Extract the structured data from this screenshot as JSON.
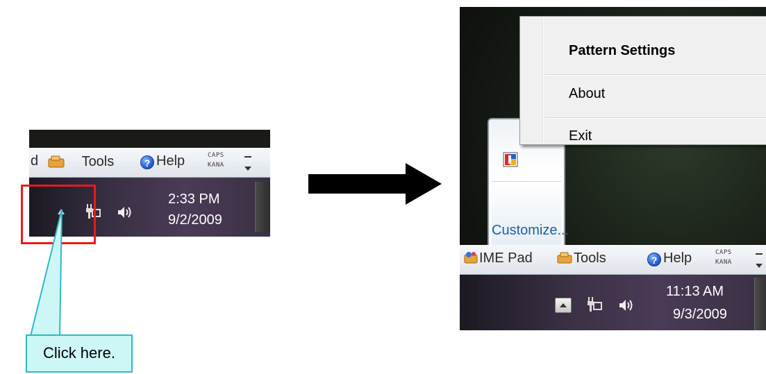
{
  "left": {
    "langbar": {
      "ime_fragment": "d",
      "tools": "Tools",
      "help": "Help",
      "caps": "CAPS",
      "kana": "KANA"
    },
    "clock": {
      "time": "2:33 PM",
      "date": "9/2/2009"
    }
  },
  "callout": {
    "text": "Click here."
  },
  "right": {
    "menu": {
      "items": [
        "Pattern Settings",
        "About",
        "Exit"
      ]
    },
    "overflow": {
      "customize": "Customize..."
    },
    "langbar": {
      "ime_pad": "IME Pad",
      "tools": "Tools",
      "help": "Help",
      "caps": "CAPS",
      "kana": "KANA"
    },
    "clock": {
      "time": "11:13 AM",
      "date": "9/3/2009"
    }
  },
  "colors": {
    "highlight": "#e81b1b",
    "callout_fill": "#cdf7f7",
    "callout_border": "#2fb9c6",
    "arrow": "#000000"
  },
  "icons": [
    "tools-icon",
    "help-icon",
    "ime-pad-icon",
    "network-icon",
    "volume-icon",
    "show-hidden-icons-arrow",
    "pattern-app-icon"
  ]
}
